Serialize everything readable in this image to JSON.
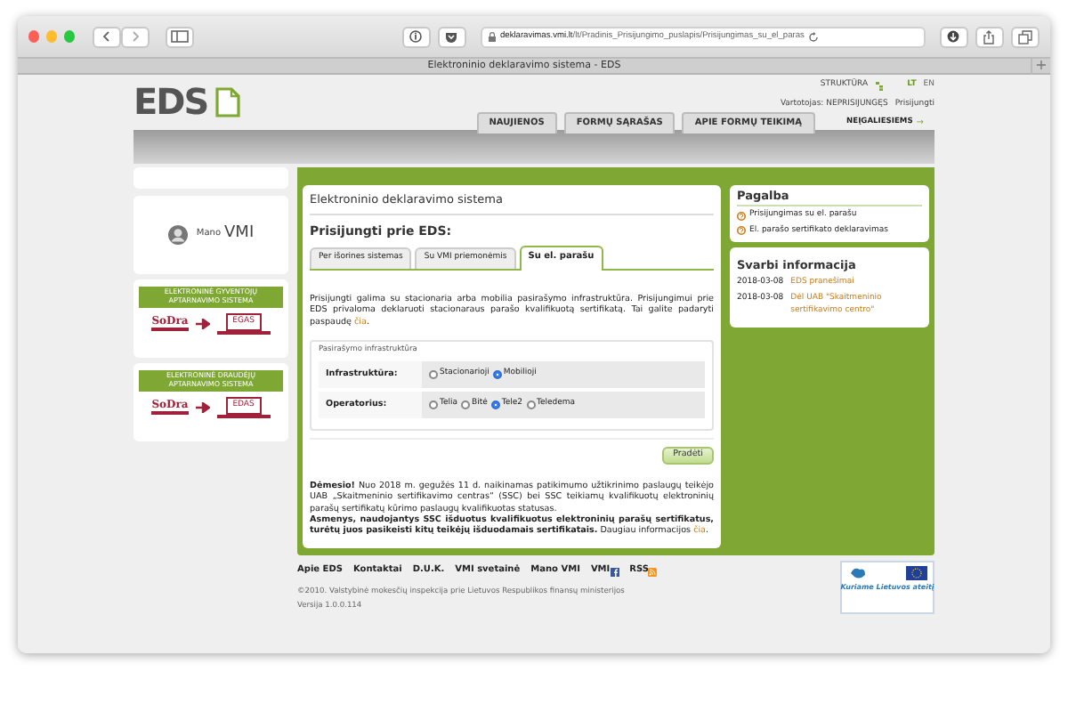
{
  "browser": {
    "url_domain": "deklaravimas.vmi.lt",
    "url_path": "/lt/Pradinis_Prisijungimo_puslapis/Prisijungimas_su_el_paras",
    "tab_title": "Elektroninio deklaravimo sistema - EDS",
    "new_tab": "+"
  },
  "header": {
    "logo": "EDS",
    "structure_link": "STRUKTŪRA",
    "languages": [
      {
        "label": "LT",
        "selected": true
      },
      {
        "label": "EN",
        "selected": false
      }
    ],
    "user": "Vartotojas: NEPRISIJUNGĘS",
    "login": "Prisijungti",
    "nav_tabs": [
      "NAUJIENOS",
      "FORMŲ SĄRAŠAS",
      "APIE FORMŲ TEIKIMĄ"
    ],
    "accessibility_link": "NEĮGALIESIEMS",
    "accessibility_arrow": "→"
  },
  "sidebar": {
    "mano_vmi": {
      "small": "Mano",
      "big": "VMI"
    },
    "banners": [
      {
        "title": "ELEKTRONINĖ GYVENTOJŲ APTARNAVIMO SISTEMA",
        "brand": "SoDra",
        "system": "EGAS"
      },
      {
        "title": "ELEKTRONINĖ DRAUDĖJŲ APTARNAVIMO SISTEMA",
        "brand": "SoDra",
        "system": "EDAS"
      }
    ]
  },
  "main": {
    "title": "Elektroninio deklaravimo sistema",
    "heading": "Prisijungti prie EDS:",
    "tabs": [
      {
        "label": "Per išorines sistemas",
        "selected": false
      },
      {
        "label": "Su VMI priemonėmis",
        "selected": false
      },
      {
        "label": "Su el. parašu",
        "selected": true
      }
    ],
    "intro": "Prisijungti galima su stacionaria arba mobilia pasirašymo infrastruktūra. Prisijungimui prie EDS privaloma deklaruoti stacionaraus parašo kvalifikuotą sertifikatą. Tai galite padaryti paspaudę",
    "intro_link": "čia",
    "intro_end": ".",
    "fieldset": {
      "legend": "Pasirašymo infrastruktūra",
      "rows": [
        {
          "label": "Infrastruktūra:",
          "options": [
            {
              "label": "Stacionarioji",
              "selected": false
            },
            {
              "label": "Mobilioji",
              "selected": true
            }
          ]
        },
        {
          "label": "Operatorius:",
          "options": [
            {
              "label": "Telia",
              "selected": false
            },
            {
              "label": "Bitė",
              "selected": false
            },
            {
              "label": "Tele2",
              "selected": true
            },
            {
              "label": "Teledema",
              "selected": false
            }
          ]
        }
      ]
    },
    "start_button": "Pradėti",
    "notice": "**Dėmesio!** Nuo 2018 m. gegužės 11 d. naikinamas patikimumo užtikrinimo paslaugų teikėjo UAB „Skaitmeninio sertifikavimo centras“ (SSC) bei SSC teikiamų kvalifikuotų elektroninių parašų sertifikatų kūrimo paslaugų kvalifikuotas statusas.",
    "notice_2": "**Asmenys, naudojantys SSC išduotus kvalifikuotus elektroninių parašų sertifikatus, turėtų juos pasikeisti kitų teikėjų išduodamais sertifikatais.** Daugiau informacijos",
    "notice_link": "čia",
    "notice_end": "."
  },
  "help": {
    "title": "Pagalba",
    "items": [
      "Prisijungimas su el. parašu",
      "El. parašo sertifikato deklaravimas"
    ]
  },
  "info": {
    "title": "Svarbi informacija",
    "items": [
      {
        "date": "2018-03-08",
        "text": "EDS pranešimai"
      },
      {
        "date": "2018-03-08",
        "text": "Dėl UAB \"Skaitmeninio sertifikavimo centro\""
      }
    ]
  },
  "footer": {
    "links": [
      {
        "label": "Apie EDS",
        "kind": "plain"
      },
      {
        "label": "Kontaktai",
        "kind": "plain"
      },
      {
        "label": "D.U.K.",
        "kind": "plain"
      },
      {
        "label": "VMI svetainė",
        "kind": "plain"
      },
      {
        "label": "Mano VMI",
        "kind": "plain"
      },
      {
        "label": "VMI",
        "kind": "facebook"
      },
      {
        "label": "RSS",
        "kind": "rss"
      }
    ],
    "copyright": "©2010. Valstybinė mokesčių inspekcija prie Lietuvos Respublikos finansų ministerijos",
    "version": "Versija 1.0.0.114",
    "eu_slogan": "Kuriame Lietuvos ateitį"
  }
}
